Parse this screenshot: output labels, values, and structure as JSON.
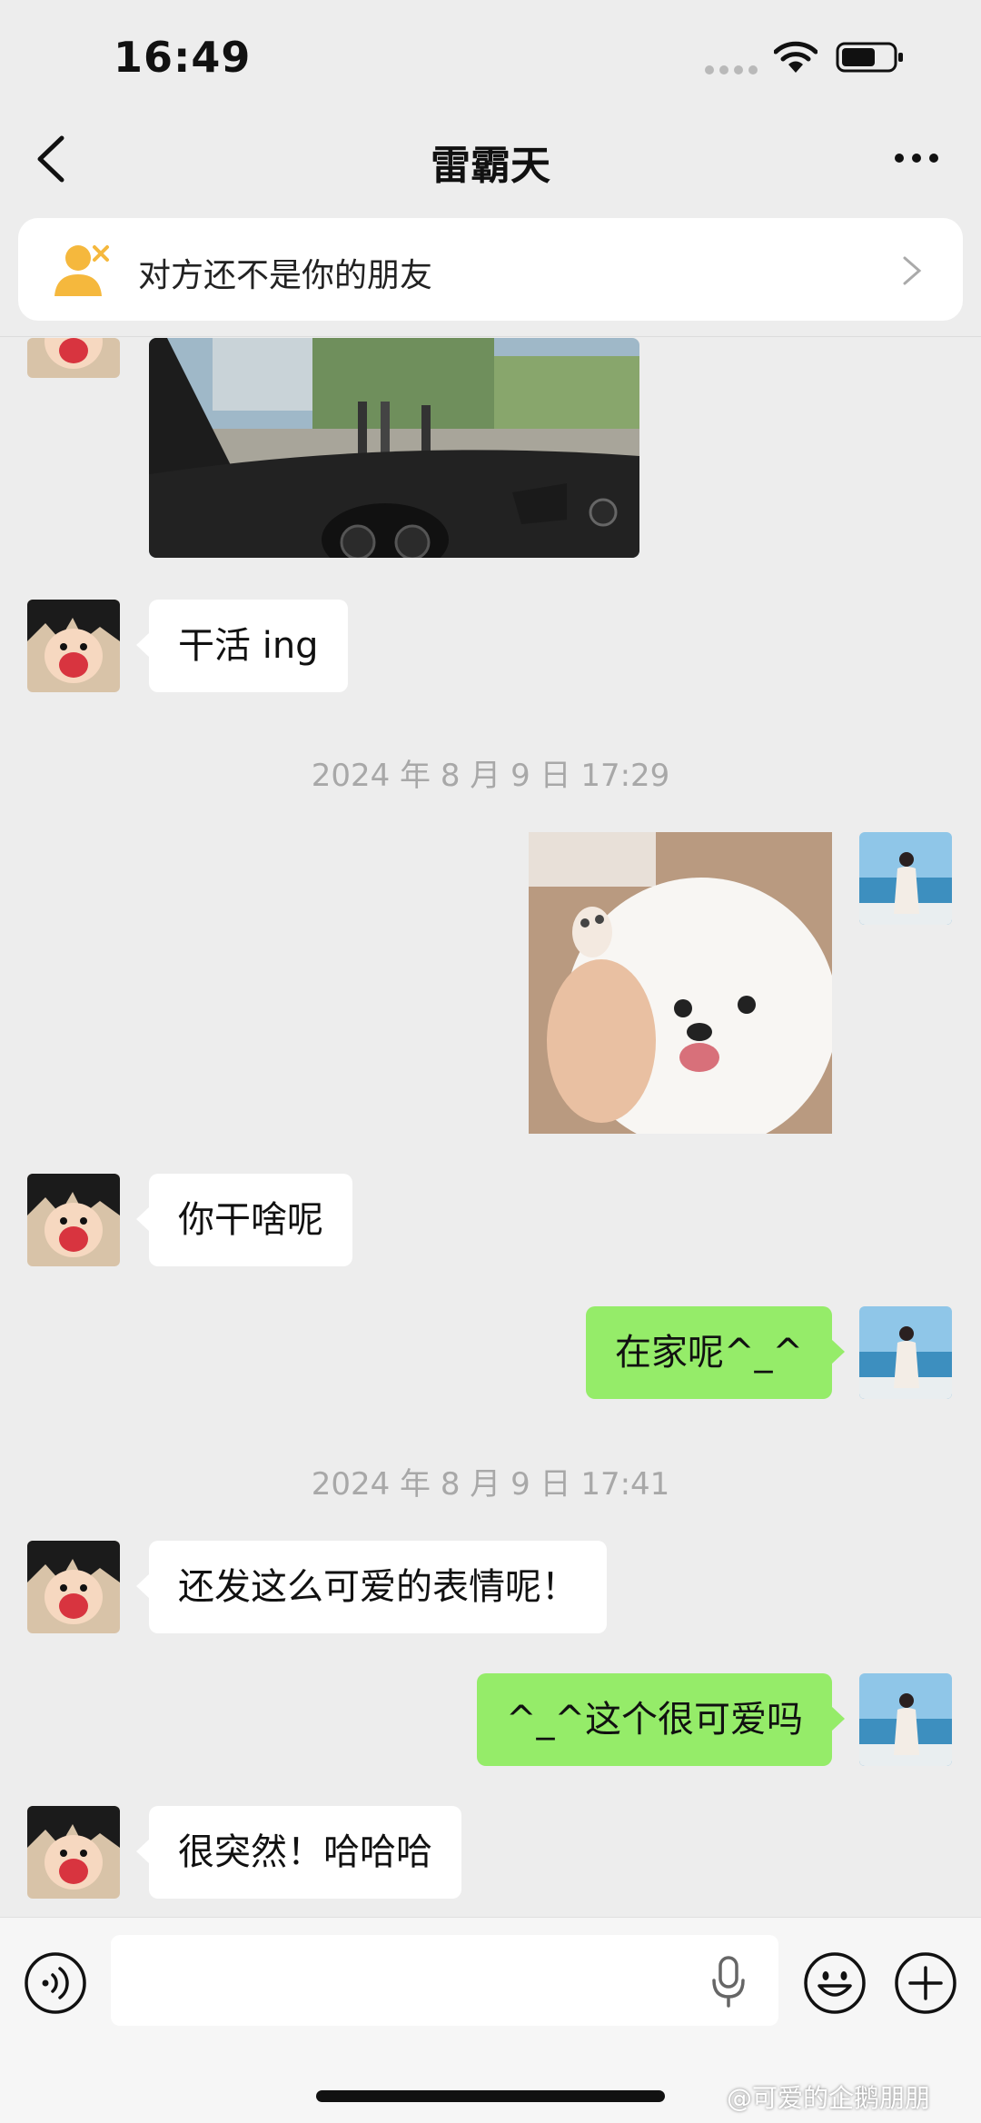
{
  "status_bar": {
    "time": "16:49"
  },
  "nav": {
    "title": "雷霸天"
  },
  "notice": {
    "text": "对方还不是你的朋友"
  },
  "messages": {
    "m1": "干活 ing",
    "ts1": "2024 年 8 月 9 日 17:29",
    "m2": "你干啥呢",
    "m3": "在家呢^_^",
    "ts2": "2024 年 8 月 9 日 17:41",
    "m4": "还发这么可爱的表情呢！",
    "m5": "^_^这个很可爱吗",
    "m6": "很突然！哈哈哈"
  },
  "watermark": "@可爱的企鹅朋朋",
  "colors": {
    "sent_bubble": "#95ec69",
    "received_bubble": "#ffffff",
    "background": "#ededed",
    "notice_icon": "#f5b83d"
  },
  "icons": [
    "back-chevron-icon",
    "more-dots-icon",
    "user-x-icon",
    "chevron-right-icon",
    "voice-icon",
    "mic-icon",
    "emoji-icon",
    "plus-icon",
    "wifi-icon",
    "battery-icon"
  ]
}
